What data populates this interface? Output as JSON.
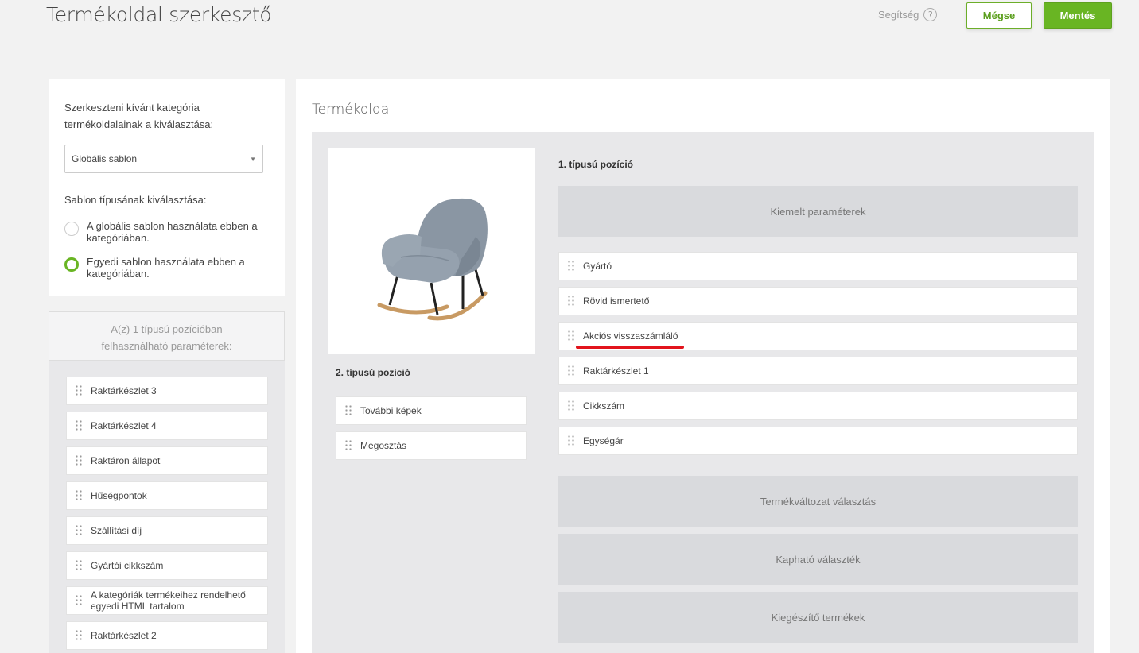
{
  "header": {
    "title": "Termékoldal szerkesztő",
    "help_label": "Segítség",
    "help_icon": "?",
    "cancel_label": "Mégse",
    "save_label": "Mentés"
  },
  "sidebar": {
    "category_label_line1": "Szerkeszteni kívánt kategória",
    "category_label_line2": "termékoldalainak a kiválasztása:",
    "category_select_value": "Globális sablon",
    "template_type_label": "Sablon típusának kiválasztása:",
    "radio_options": [
      {
        "line1": "A globális sablon használata ebben a",
        "line2": "kategóriában.",
        "checked": false
      },
      {
        "line1": "Egyedi sablon használata ebben a",
        "line2": "kategóriában.",
        "checked": true
      }
    ],
    "params_header_line1": "A(z) 1 típusú pozícióban",
    "params_header_line2": "felhasználható paraméterek:",
    "params": [
      {
        "line1": "Raktárkészlet 3",
        "line2": ""
      },
      {
        "line1": "Raktárkészlet 4",
        "line2": ""
      },
      {
        "line1": "Raktáron állapot",
        "line2": ""
      },
      {
        "line1": "Hűségpontok",
        "line2": ""
      },
      {
        "line1": "Szállítási díj",
        "line2": ""
      },
      {
        "line1": "Gyártói cikkszám",
        "line2": ""
      },
      {
        "line1": "A kategóriák termékeihez rendelhető",
        "line2": "egyedi HTML tartalom"
      },
      {
        "line1": "Raktárkészlet 2",
        "line2": ""
      }
    ]
  },
  "main": {
    "title": "Termékoldal",
    "position1_label": "1. típusú pozíció",
    "position2_label": "2. típusú pozíció",
    "position2_items": [
      "További képek",
      "Megosztás"
    ],
    "position1_block_top": "Kiemelt paraméterek",
    "position1_items": [
      "Gyártó",
      "Rövid ismertető",
      "Akciós visszaszámláló",
      "Raktárkészlet 1",
      "Cikkszám",
      "Egységár"
    ],
    "position1_blocks_bottom": [
      "Termékváltozat választás",
      "Kapható választék",
      "Kiegészítő termékek"
    ]
  },
  "colors": {
    "accent": "#69b523",
    "underline": "#e2141c",
    "chair": "#8a96a3"
  }
}
